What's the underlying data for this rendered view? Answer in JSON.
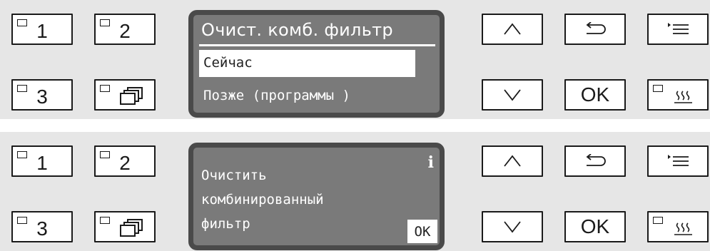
{
  "panel_top": {
    "keys": {
      "prog1": "1",
      "prog2": "2",
      "prog3": "3",
      "ok": "OK"
    },
    "display": {
      "title": "Очист. комб. фильтр",
      "selected_option": "Сейчас",
      "option2": "Позже (программы )"
    }
  },
  "panel_bottom": {
    "keys": {
      "prog1": "1",
      "prog2": "2",
      "prog3": "3",
      "ok": "OK"
    },
    "display": {
      "line1": "Очистить",
      "line2": "комбинированный",
      "line3": "фильтр",
      "info_symbol": "i",
      "ok_label": "OK"
    }
  },
  "icons": {
    "program_list": "stacked-windows-icon",
    "up": "chevron-up-icon",
    "down": "chevron-down-icon",
    "back": "return-arrow-icon",
    "menu": "menu-list-icon",
    "drying": "heat-waves-icon"
  },
  "colors": {
    "display_bg": "#7a7a7a",
    "display_frame": "#4a4a4a",
    "panel_bg": "#e6e6e6",
    "key_border": "#1a1a1a"
  }
}
